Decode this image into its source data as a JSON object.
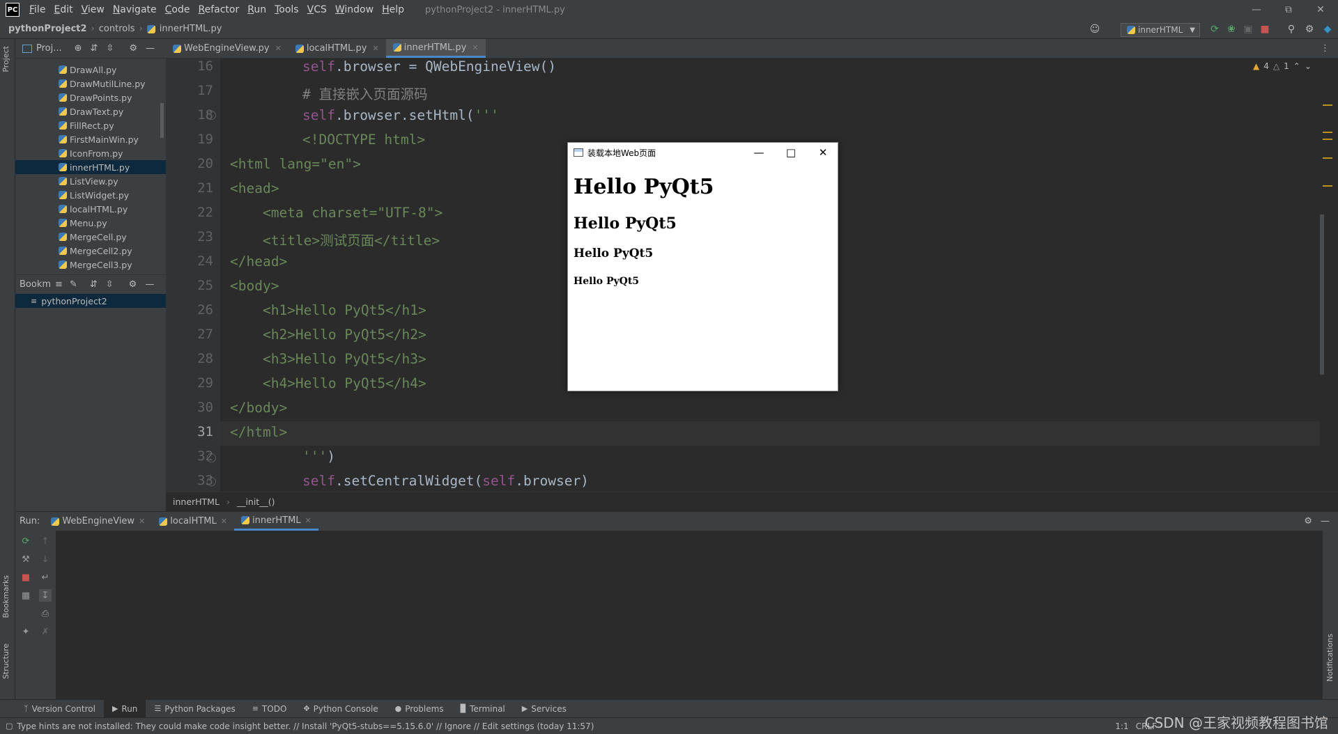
{
  "app": {
    "logo": "PC",
    "window_title": "pythonProject2 - innerHTML.py",
    "menu": [
      "File",
      "Edit",
      "View",
      "Navigate",
      "Code",
      "Refactor",
      "Run",
      "Tools",
      "VCS",
      "Window",
      "Help"
    ]
  },
  "navbar": {
    "project": "pythonProject2",
    "folder": "controls",
    "file": "innerHTML.py",
    "run_config": "innerHTML"
  },
  "project_panel": {
    "title": "Proj...",
    "files": [
      "DrawAll.py",
      "DrawMutilLine.py",
      "DrawPoints.py",
      "DrawText.py",
      "FillRect.py",
      "FirstMainWin.py",
      "IconFrom.py",
      "innerHTML.py",
      "ListView.py",
      "ListWidget.py",
      "localHTML.py",
      "Menu.py",
      "MergeCell.py",
      "MergeCell2.py",
      "MergeCell3.py"
    ],
    "selected": "innerHTML.py",
    "bookmarks_title": "Bookm",
    "bookmarks_item": "pythonProject2"
  },
  "side_labels": {
    "project": "Project",
    "bookmarks": "Bookmarks",
    "structure": "Structure",
    "notifications": "Notifications"
  },
  "editor_tabs": [
    {
      "label": "WebEngineView.py"
    },
    {
      "label": "localHTML.py"
    },
    {
      "label": "innerHTML.py"
    }
  ],
  "editor": {
    "line_numbers": [
      "16",
      "17",
      "18",
      "19",
      "20",
      "21",
      "22",
      "23",
      "24",
      "25",
      "26",
      "27",
      "28",
      "29",
      "30",
      "31",
      "32",
      "33"
    ],
    "current_line": "31",
    "inspections": {
      "warnings": "4",
      "weak_warnings": "1"
    }
  },
  "breadcrumb": {
    "class_name": "innerHTML",
    "method_name": "__init__()"
  },
  "run_panel": {
    "label": "Run:",
    "tabs": [
      "WebEngineView",
      "localHTML",
      "innerHTML"
    ]
  },
  "bottom_tools": [
    "Version Control",
    "Run",
    "Python Packages",
    "TODO",
    "Python Console",
    "Problems",
    "Terminal",
    "Services"
  ],
  "status": {
    "message": "Type hints are not installed: They could make code insight better. // Install 'PyQt5-stubs==5.15.6.0' // Ignore // Edit settings (today 11:57)",
    "position": "1:1",
    "encoding": "CRLF"
  },
  "popup": {
    "title": "装载本地Web页面",
    "h1": "Hello PyQt5",
    "h2": "Hello PyQt5",
    "h3": "Hello PyQt5",
    "h4": "Hello PyQt5"
  },
  "watermark": "CSDN @王家视频教程图书馆"
}
